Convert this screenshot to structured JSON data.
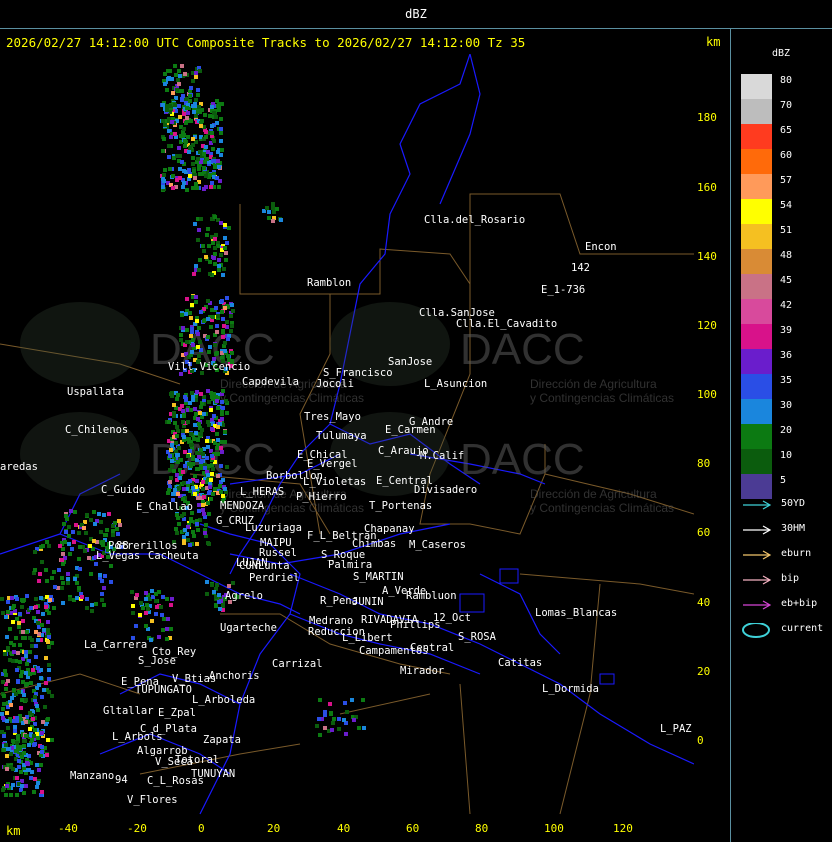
{
  "header": {
    "title": "dBZ"
  },
  "map": {
    "title": "2026/02/27 14:12:00 UTC Composite Tracks to 2026/02/27 14:12:00 Tz 35",
    "axis_unit": "km",
    "y_ticks": [
      "180",
      "160",
      "140",
      "120",
      "100",
      "80",
      "60",
      "40",
      "20",
      "0"
    ],
    "x_ticks": [
      "-40",
      "-20",
      "0",
      "20",
      "40",
      "60",
      "80",
      "100",
      "120"
    ],
    "watermark_lines": [
      "DACC",
      "Dirección de Agricultura",
      "y Contingencias Climáticas"
    ],
    "places": [
      "Clla.del_Rosario",
      "Encon",
      "142",
      "E_1-736",
      "Ramblon",
      "Clla.SanJose",
      "Clla.El_Cavadito",
      "Vill.Vicencio",
      "Capdevila",
      "S_Francisco",
      "SanJose",
      "L_Asuncion",
      "Uspallata",
      "Jocoli",
      "C_Chilenos",
      "Tres_Mayo",
      "G_Andre",
      "Tulumaya",
      "E_Carmen",
      "C_Araujo",
      "M.Calif",
      "E_Chical",
      "E_Vergel",
      "aredas",
      "Borbollon",
      "L_Violetas",
      "E_Central",
      "Divisadero",
      "C_Guido",
      "L_HERAS",
      "P_Hierro",
      "E_Challao",
      "MENDOZA",
      "T_Portenas",
      "G_CRUZ",
      "Luzuriaga",
      "Chapanay",
      "F_L_Beltran",
      "Potrerillos",
      "MAIPU",
      "Chimbas",
      "M_Caseros",
      "L_Vegas",
      "Cacheuta",
      "Russel",
      "S_Roque",
      "LUJAN",
      "Palmira",
      "CUNLunta",
      "Perdriel",
      "S_MARTIN",
      "A_Verde",
      "Agrelo",
      "R_Pena",
      "JUNIN",
      "Rambluon",
      "Lomas_Blancas",
      "Medrano",
      "RIVADAVIA",
      "Phillips",
      "12_Oct",
      "Ugarteche",
      "Reduccion",
      "L_Libert",
      "S_ROSA",
      "La_Carrera",
      "Cto_Rey",
      "S_Jose",
      "Campamentos",
      "Central",
      "Carrizal",
      "Catitas",
      "Anchoris",
      "V_Btias",
      "E_Pena",
      "TUPUNGATO",
      "Mirador",
      "L_Dormida",
      "L_Arboleda",
      "Gltallar",
      "E_Zpal",
      "L_Arbols",
      "C_d_Plata",
      "Zapata",
      "L_PAZ",
      "Algarrob",
      "V_Seca",
      "Totoral",
      "TUNUYAN",
      "Manzano",
      "C_L_Rosas",
      "V_Flores",
      "88",
      "94"
    ]
  },
  "legend": {
    "unit": "dBZ",
    "scale": [
      {
        "value": "80",
        "color": "#d9d9d9"
      },
      {
        "value": "70",
        "color": "#bdbdbd"
      },
      {
        "value": "65",
        "color": "#ff3b1f"
      },
      {
        "value": "60",
        "color": "#ff6a0a"
      },
      {
        "value": "57",
        "color": "#ff9a5a"
      },
      {
        "value": "54",
        "color": "#ffff00"
      },
      {
        "value": "51",
        "color": "#f5c021"
      },
      {
        "value": "48",
        "color": "#d98b35"
      },
      {
        "value": "45",
        "color": "#c97286"
      },
      {
        "value": "42",
        "color": "#d84a9c"
      },
      {
        "value": "39",
        "color": "#d8128a"
      },
      {
        "value": "36",
        "color": "#6a1dcc"
      },
      {
        "value": "35",
        "color": "#2a4ee6"
      },
      {
        "value": "30",
        "color": "#1a86dd"
      },
      {
        "value": "20",
        "color": "#0c7a12"
      },
      {
        "value": "10",
        "color": "#0b5c0d"
      },
      {
        "value": "5",
        "color": "#4b3b94"
      }
    ],
    "tracks": [
      {
        "label": "50YD",
        "color": "#3fd1d8"
      },
      {
        "label": "30HM",
        "color": "#ffffff"
      },
      {
        "label": "eburn",
        "color": "#f3c56b"
      },
      {
        "label": "bip",
        "color": "#f5b2c2"
      },
      {
        "label": "eb+bip",
        "color": "#d545d5"
      },
      {
        "label": "current",
        "color": "#3fd1d8"
      }
    ]
  }
}
